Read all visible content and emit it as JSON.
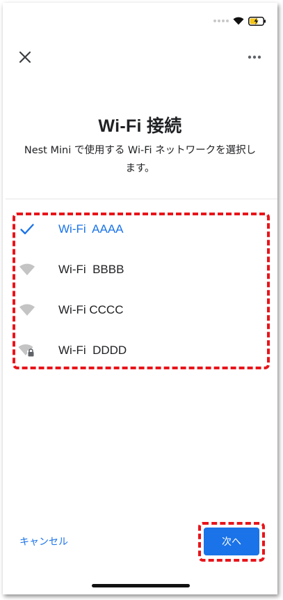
{
  "header": {
    "close_icon": "close-icon",
    "more_icon": "more-vert-icon"
  },
  "main": {
    "title": "Wi-Fi 接続",
    "description": "Nest Mini で使用する Wi-Fi ネットワークを選択します。"
  },
  "networks": [
    {
      "name": "Wi-Fi  AAAA",
      "icon": "checkmark-icon",
      "selected": true
    },
    {
      "name": "Wi-Fi  BBBB",
      "icon": "wifi-icon",
      "selected": false
    },
    {
      "name": "Wi-Fi CCCC",
      "icon": "wifi-icon",
      "selected": false
    },
    {
      "name": "Wi-Fi  DDDD",
      "icon": "wifi-lock-icon",
      "selected": false
    }
  ],
  "footer": {
    "cancel_label": "キャンセル",
    "next_label": "次へ"
  },
  "colors": {
    "accent": "#1a73e8",
    "highlight_box": "#e8141a"
  }
}
